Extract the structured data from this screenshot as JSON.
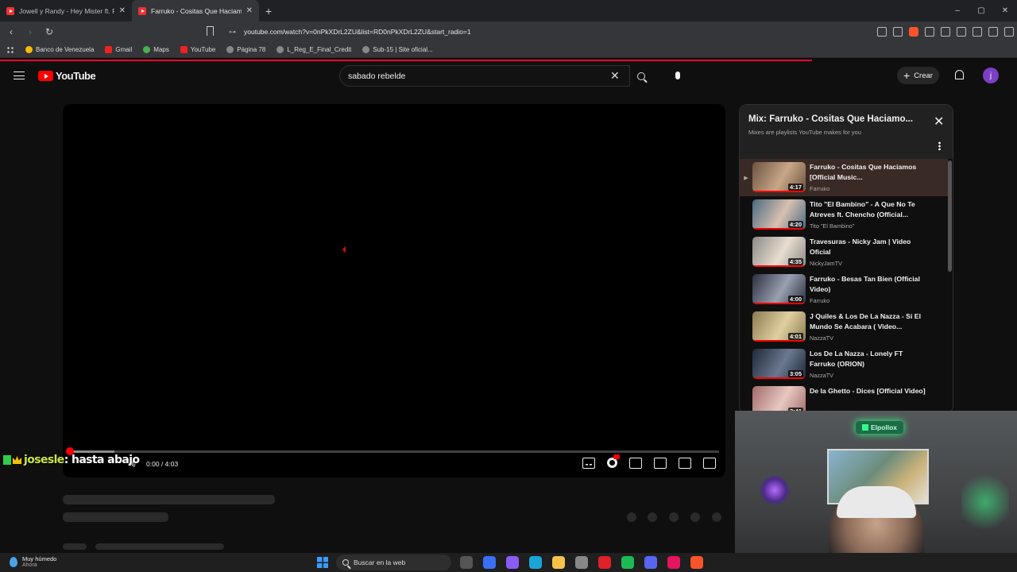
{
  "browser": {
    "tabs": [
      {
        "title": "Jowell y Randy - Hey Mister ft. Falo, Y"
      },
      {
        "title": "Farruko - Cositas Que Haciamos"
      }
    ],
    "url": "youtube.com/watch?v=0nPkXDrL2ZU&list=RD0nPkXDrL2ZU&start_radio=1",
    "bookmarks": [
      "Banco de Venezuela",
      "Gmail",
      "Maps",
      "YouTube",
      "Página 78",
      "L_Reg_E_Final_Credit",
      "Sub-15 | Site oficial..."
    ],
    "window_controls": [
      "–",
      "▢",
      "✕"
    ]
  },
  "youtube": {
    "logo_text": "YouTube",
    "search_value": "sabado rebelde",
    "create_label": "Crear",
    "avatar_letter": "j"
  },
  "player": {
    "time": "0:00 / 4:03",
    "progress_percent": 0.4
  },
  "chat": {
    "user": "josesle",
    "message": ": hasta abajo"
  },
  "playlist": {
    "title": "Mix: Farruko - Cositas Que Haciamo...",
    "subtitle": "Mixes are playlists YouTube makes for you",
    "current_marker": "▶",
    "items": [
      {
        "title": "Farruko - Cositas Que Haciamos [Official Music...",
        "channel": "Farruko",
        "duration": "4:17",
        "current": true,
        "colors": [
          "#6b5340",
          "#c9a788"
        ]
      },
      {
        "title": "Tito \"El Bambino\" - A Que No Te Atreves ft. Chencho (Official...",
        "channel": "Tito \"El Bambino\"",
        "duration": "4:20",
        "colors": [
          "#4a6a80",
          "#d8c0b0"
        ]
      },
      {
        "title": "Travesuras - Nicky Jam | Video Oficial",
        "channel": "NickyJamTV",
        "duration": "4:35",
        "colors": [
          "#8a8a88",
          "#e8ddd0"
        ]
      },
      {
        "title": "Farruko - Besas Tan Bien (Official Video)",
        "channel": "Farruko",
        "duration": "4:00",
        "colors": [
          "#2a3040",
          "#9aa0b0"
        ]
      },
      {
        "title": "J Quiles & Los De La Nazza - Si El Mundo Se Acabara ( Video...",
        "channel": "NazzaTV",
        "duration": "4:01",
        "colors": [
          "#8a7a50",
          "#e0d0a0"
        ]
      },
      {
        "title": "Los De La Nazza - Lonely FT Farruko (ORION)",
        "channel": "NazzaTV",
        "duration": "3:05",
        "colors": [
          "#202838",
          "#6a7890"
        ]
      },
      {
        "title": "De la Ghetto - Dices [Official Video]",
        "channel": "",
        "duration": "3:41",
        "colors": [
          "#a06a6a",
          "#e8c8c0"
        ]
      }
    ]
  },
  "webcam": {
    "neon_sign": "Elpollox"
  },
  "taskbar": {
    "weather_title": "Muy húmedo",
    "weather_sub": "Ahora",
    "search_placeholder": "Buscar en la web",
    "apps": [
      {
        "icon": "task-view-icon",
        "color": "#555"
      },
      {
        "icon": "store-icon",
        "color": "#3a6ff7"
      },
      {
        "icon": "copilot-icon",
        "color": "#8a5cf6"
      },
      {
        "icon": "edge-icon",
        "color": "#1aa5d6"
      },
      {
        "icon": "files-icon",
        "color": "#f5c24a"
      },
      {
        "icon": "chrome-icon",
        "color": "#888"
      },
      {
        "icon": "opera-icon",
        "color": "#e0202a"
      },
      {
        "icon": "spotify-icon",
        "color": "#1db954"
      },
      {
        "icon": "discord-icon",
        "color": "#5865f2"
      },
      {
        "icon": "tiktok-icon",
        "color": "#e4145e"
      },
      {
        "icon": "brave-icon",
        "color": "#fb542b"
      }
    ]
  }
}
